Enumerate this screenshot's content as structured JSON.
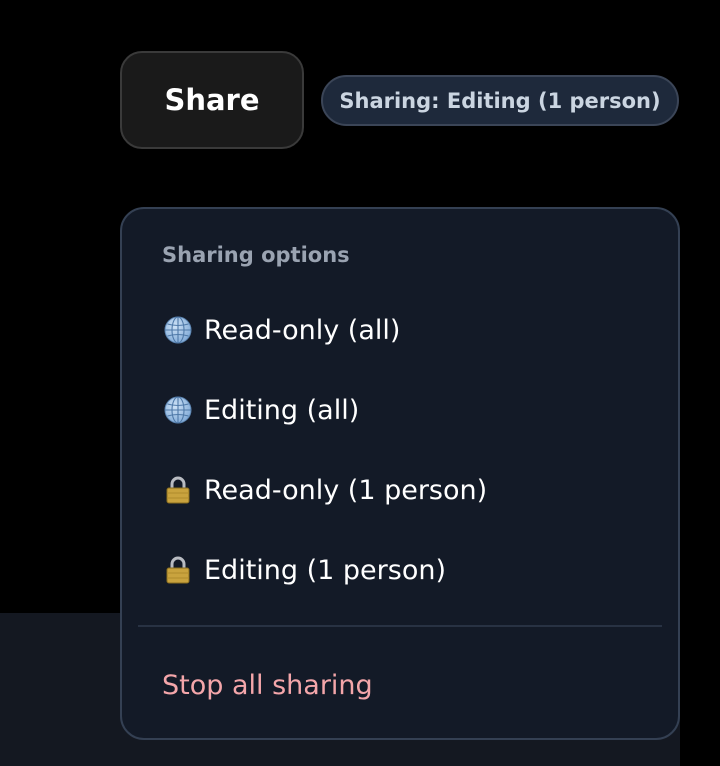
{
  "share_button": {
    "label": "Share"
  },
  "status_badge": {
    "text": "Sharing: Editing (1 person)"
  },
  "menu": {
    "heading": "Sharing options",
    "items": [
      {
        "icon": "globe-icon",
        "label": "Read-only (all)"
      },
      {
        "icon": "globe-icon",
        "label": "Editing (all)"
      },
      {
        "icon": "lock-icon",
        "label": "Read-only (1 person)"
      },
      {
        "icon": "lock-icon",
        "label": "Editing (1 person)"
      }
    ],
    "stop_label": "Stop all sharing",
    "stop_color": "#f4a6aa"
  },
  "colors": {
    "background": "#000000",
    "menu_background": "#131a27",
    "badge_background": "#1e293b"
  }
}
